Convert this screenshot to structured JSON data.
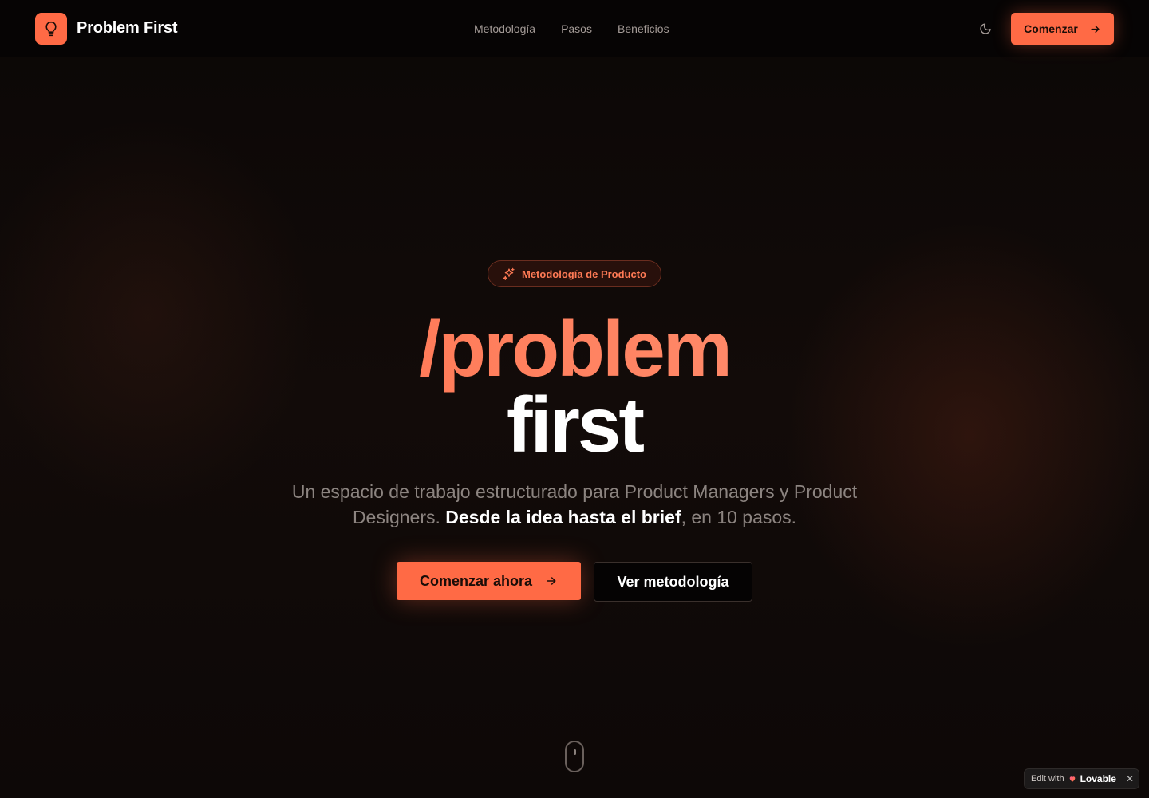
{
  "nav": {
    "brand": "Problem First",
    "links": [
      "Metodología",
      "Pasos",
      "Beneficios"
    ],
    "cta": "Comenzar"
  },
  "hero": {
    "badge": "Metodología de Producto",
    "title_line1": "/problem",
    "title_line2": "first",
    "subtitle_part1": "Un espacio de trabajo estructurado para Product Managers y Product Designers.",
    "subtitle_strong": "Desde la idea hasta el brief",
    "subtitle_part2": ", en 10 pasos.",
    "primary_button": "Comenzar ahora",
    "secondary_button": "Ver metodología"
  },
  "lovable": {
    "prefix": "Edit with",
    "name": "Lovable",
    "close": "✕"
  },
  "colors": {
    "accent": "#ff6a45",
    "background": "#0c0807"
  },
  "icons": [
    "lightbulb-icon",
    "moon-icon",
    "arrow-right-icon",
    "sparkles-icon",
    "mouse-icon",
    "heart-icon",
    "close-icon"
  ]
}
